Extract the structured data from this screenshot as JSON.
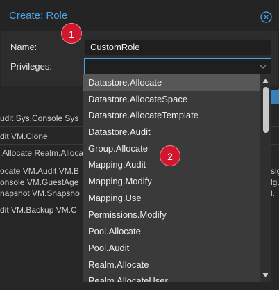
{
  "background": {
    "rows": [
      {
        "cells": [
          "udit Sys.Console Sys"
        ]
      },
      {
        "cells": [
          "dit VM.Clone"
        ]
      },
      {
        "cells": [
          ".Allocate Realm.Alloca"
        ]
      },
      {
        "cells": [
          "ocate VM.Audit VM.B",
          "onsole VM.GuestAge",
          "napshot VM.Snapsho"
        ],
        "extra": [
          "sig.",
          "lg. Gr",
          "l."
        ]
      },
      {
        "cells": [
          "dit VM.Backup VM.C"
        ]
      }
    ]
  },
  "dialog": {
    "title": "Create: Role",
    "name_label": "Name:",
    "name_value": "CustomRole",
    "privileges_label": "Privileges:",
    "privileges_value": ""
  },
  "dropdown": {
    "items": [
      "Datastore.Allocate",
      "Datastore.AllocateSpace",
      "Datastore.AllocateTemplate",
      "Datastore.Audit",
      "Group.Allocate",
      "Mapping.Audit",
      "Mapping.Modify",
      "Mapping.Use",
      "Permissions.Modify",
      "Pool.Allocate",
      "Pool.Audit",
      "Realm.Allocate",
      "Realm.AllocateUser"
    ],
    "selected_index": 0
  },
  "badges": [
    "1",
    "2"
  ],
  "colors": {
    "accent": "#4ba3e3",
    "badge": "#d1172e"
  }
}
